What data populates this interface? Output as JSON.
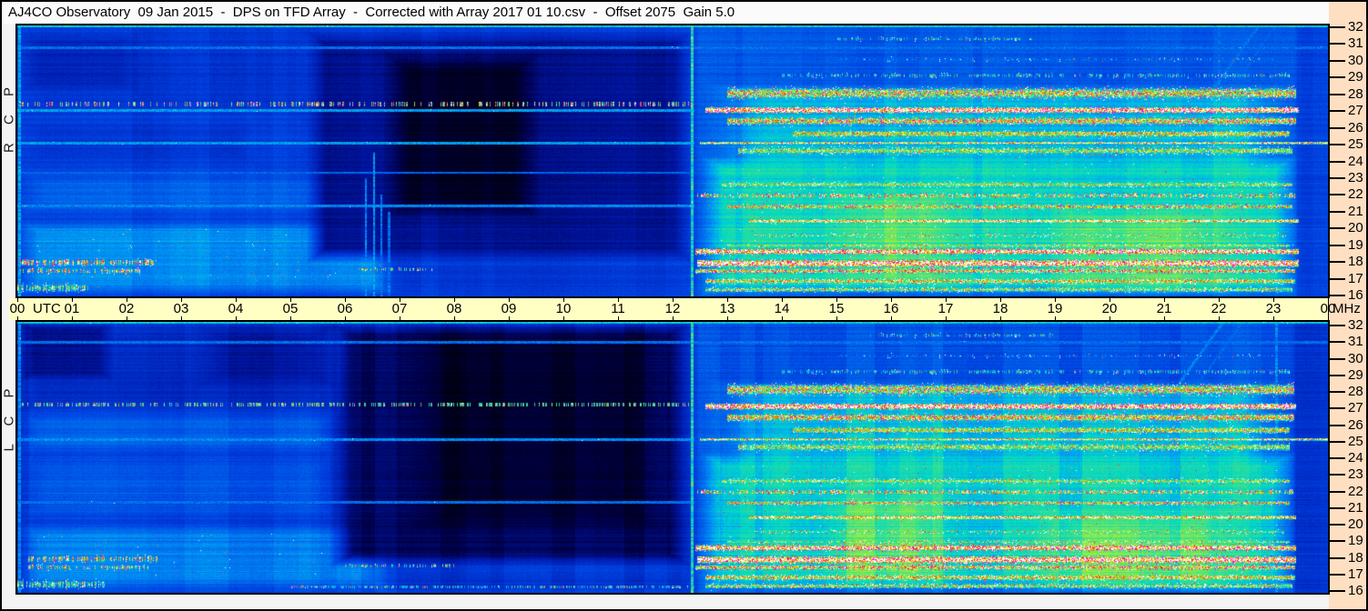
{
  "window": {
    "title": "AJ4CO Observatory  09 Jan 2015  -  DPS on TFD Array  -  Corrected with Array 2017 01 10.csv  -  Offset 2075  Gain 5.0"
  },
  "colors": {
    "outer_border": "#000000",
    "title_bg": "#fbfbfb",
    "margin_bg": "#f4f4f4",
    "time_strip_bg": "#ffffc4",
    "freq_col_bg": "#ffdfc2",
    "label_text": "#000000"
  },
  "time_axis": {
    "left_label": "00",
    "utc": "UTC",
    "hours": [
      "01",
      "02",
      "03",
      "04",
      "05",
      "06",
      "07",
      "08",
      "09",
      "10",
      "11",
      "12",
      "13",
      "14",
      "15",
      "16",
      "17",
      "18",
      "19",
      "20",
      "21",
      "22",
      "23"
    ],
    "right_label": "00",
    "unit": "MHz"
  },
  "freq_axis": {
    "ticks": [
      32,
      31,
      30,
      29,
      28,
      27,
      26,
      25,
      24,
      23,
      22,
      21,
      20,
      19,
      18,
      17,
      16
    ]
  },
  "chart_data": {
    "type": "heatmap",
    "title": "AJ4CO Observatory  09 Jan 2015  -  DPS on TFD Array  -  Corrected with Array 2017 01 10.csv  -  Offset 2075  Gain 5.0",
    "x_axis": {
      "label": "UTC",
      "unit": "hours",
      "min": 0,
      "max": 24
    },
    "y_axis": {
      "label": "MHz",
      "min": 16,
      "max": 32,
      "ticks": [
        32,
        31,
        30,
        29,
        28,
        27,
        26,
        25,
        24,
        23,
        22,
        21,
        20,
        19,
        18,
        17,
        16
      ]
    },
    "legend": "none",
    "notable_features": [
      "quiet blue background 00:00-12:20 UTC with black receiver-dropout region near 05:30-12:20",
      "broadband daytime emission 12:25-23:30 UTC with saturated white band at 27.0 MHz",
      "continuous carrier lines at 25.05 and 27 MHz; strong low-band lines at 16.4-22.6 MHz",
      "vertical calibration line at 12:21 UTC in both polarizations; early-morning bursts 17.5-18 MHz 00:00-02:30"
    ],
    "colormap": [
      [
        0.0,
        "#000000"
      ],
      [
        0.08,
        "#000048"
      ],
      [
        0.18,
        "#0018a8"
      ],
      [
        0.3,
        "#0040e0"
      ],
      [
        0.42,
        "#0078f0"
      ],
      [
        0.5,
        "#00a8f0"
      ],
      [
        0.57,
        "#00d8c8"
      ],
      [
        0.64,
        "#3ce08c"
      ],
      [
        0.72,
        "#90ec48"
      ],
      [
        0.8,
        "#e8f400"
      ],
      [
        0.86,
        "#ffb400"
      ],
      [
        0.92,
        "#ff5800"
      ],
      [
        0.96,
        "#ff1400"
      ],
      [
        1.0,
        "#ffffff"
      ]
    ],
    "overflow_colors": [
      "#ff00ff",
      "#ff0090",
      "#ee30ee"
    ],
    "panels": [
      {
        "id": "RCP",
        "polarization": "Right Circular Polarization",
        "side_label": "R C P",
        "seed": 11,
        "noise": {
          "row": 0.035,
          "col": 0.028,
          "grain": 0.06,
          "strong_row_p": 0.12,
          "strong_row_amp": 0.05
        },
        "regions": [
          [
            0,
            24,
            16,
            32,
            0.3,
            0,
            0
          ],
          [
            0,
            6.9,
            16,
            20.6,
            0.46,
            0.4,
            0.8
          ],
          [
            0,
            6.5,
            20.6,
            23.6,
            0.38,
            0.5,
            1.0
          ],
          [
            0,
            5.5,
            26.5,
            32,
            0.27,
            0.5,
            1.0
          ],
          [
            0,
            2.3,
            28.0,
            31.6,
            0.22,
            0.4,
            0.6
          ],
          [
            0,
            4.5,
            23.6,
            26.5,
            0.27,
            0.5,
            0.8
          ],
          [
            5.3,
            12.38,
            18.0,
            31.7,
            0.16,
            0.35,
            0.8
          ],
          [
            6.7,
            9.6,
            20.5,
            30.5,
            0.05,
            0.5,
            1.2
          ],
          [
            6.9,
            12.38,
            16,
            18.0,
            0.28,
            0.3,
            0.5
          ],
          [
            12.42,
            23.46,
            16,
            32,
            0.35,
            0.07,
            0
          ],
          [
            12.6,
            23.42,
            22.0,
            28.6,
            0.52,
            1.1,
            0.8
          ],
          [
            12.5,
            23.46,
            16,
            24.3,
            0.58,
            0.45,
            0.8
          ],
          [
            14.8,
            17.3,
            16.3,
            22.5,
            0.66,
            0.8,
            1.0
          ],
          [
            18.8,
            22.3,
            16,
            21.5,
            0.66,
            0.8,
            1.0
          ]
        ],
        "hlines": [
          [
            32.0,
            0.13,
            0,
            24,
            0.55,
            1,
            0
          ],
          [
            30.7,
            0.09,
            0,
            24,
            0.4,
            1,
            0
          ],
          [
            27.35,
            0.12,
            0,
            12.4,
            0.62,
            0.32,
            0.5
          ],
          [
            27.0,
            0.08,
            0,
            12.4,
            0.48,
            1,
            0
          ],
          [
            25.05,
            0.08,
            0,
            12.4,
            0.48,
            1,
            0
          ],
          [
            23.3,
            0.07,
            0,
            12.4,
            0.38,
            1,
            0
          ],
          [
            21.35,
            0.08,
            0,
            12.4,
            0.44,
            1,
            0
          ]
        ],
        "bands": [
          [
            28.0,
            0.45,
            13.0,
            23.42,
            0.74,
            0.28,
            1,
            1
          ],
          [
            27.0,
            0.22,
            12.6,
            23.46,
            1.02,
            0.5,
            1,
            1
          ],
          [
            26.35,
            0.3,
            13.0,
            23.42,
            0.8,
            0.3,
            1,
            1
          ],
          [
            25.6,
            0.25,
            14.2,
            23.3,
            0.78,
            0.22,
            0,
            1
          ],
          [
            25.05,
            0.09,
            12.5,
            24,
            0.97,
            0.15,
            1,
            1
          ],
          [
            24.6,
            0.3,
            13.2,
            23.35,
            0.7,
            0.15,
            0,
            1
          ],
          [
            29.05,
            0.18,
            14.0,
            23.3,
            0.55,
            0.12,
            1,
            0.5
          ],
          [
            30.0,
            0.15,
            15.0,
            23.0,
            0.42,
            0.08,
            0,
            0.4
          ],
          [
            31.2,
            0.15,
            15.0,
            18.6,
            0.55,
            0.15,
            0,
            0.4
          ],
          [
            22.6,
            0.2,
            12.9,
            23.35,
            0.68,
            0.18,
            0,
            1
          ],
          [
            21.95,
            0.18,
            12.45,
            23.4,
            0.85,
            0.3,
            1,
            0.65
          ],
          [
            21.3,
            0.18,
            13.0,
            23.35,
            0.75,
            0.25,
            1,
            1
          ],
          [
            20.45,
            0.14,
            13.4,
            23.46,
            0.95,
            0.25,
            0,
            1
          ],
          [
            19.6,
            0.15,
            13.5,
            23.2,
            0.6,
            0.12,
            0,
            1
          ],
          [
            19.0,
            0.12,
            13.0,
            23.3,
            0.7,
            0.15,
            0,
            1
          ],
          [
            18.65,
            0.22,
            12.42,
            23.46,
            0.98,
            0.45,
            1,
            1
          ],
          [
            17.95,
            0.28,
            12.45,
            23.46,
            1.0,
            0.4,
            1,
            1
          ],
          [
            17.5,
            0.18,
            12.42,
            23.4,
            0.8,
            0.35,
            1,
            1
          ],
          [
            16.9,
            0.2,
            12.6,
            23.4,
            0.78,
            0.3,
            0,
            1
          ],
          [
            16.4,
            0.2,
            12.6,
            23.35,
            0.68,
            0.2,
            0,
            1
          ],
          [
            18.0,
            0.25,
            0.05,
            2.5,
            0.82,
            0.45,
            1,
            0.55
          ],
          [
            17.5,
            0.2,
            0.05,
            2.3,
            0.75,
            0.4,
            1,
            0.5
          ],
          [
            16.5,
            0.35,
            0,
            1.3,
            0.62,
            0.2,
            0,
            0.8
          ],
          [
            17.6,
            0.15,
            6.2,
            7.6,
            0.72,
            0.35,
            1,
            0.35
          ]
        ],
        "vlines": [
          [
            12.35,
            2,
            16,
            32,
            0.6
          ],
          [
            6.38,
            1,
            16,
            23,
            0.45
          ],
          [
            6.52,
            1,
            16,
            24.5,
            0.48
          ],
          [
            6.66,
            1,
            16,
            22,
            0.44
          ],
          [
            6.8,
            1,
            16,
            21,
            0.4
          ],
          [
            22.0,
            1,
            16,
            32,
            0.4
          ],
          [
            0.03,
            2,
            16,
            32,
            0.5
          ]
        ],
        "diags": [
          [
            21.9,
            28.3,
            22.7,
            31.9,
            0.42,
            1.6
          ],
          [
            22.25,
            28.3,
            23.0,
            31.9,
            0.38,
            1.2
          ]
        ]
      },
      {
        "id": "LCP",
        "polarization": "Left Circular Polarization",
        "side_label": "L C P",
        "seed": 29,
        "noise": {
          "row": 0.035,
          "col": 0.05,
          "grain": 0.06,
          "strong_row_p": 0.14,
          "strong_row_amp": 0.05
        },
        "regions": [
          [
            0,
            24,
            16,
            32,
            0.28,
            0,
            0
          ],
          [
            0,
            6.8,
            16,
            20.2,
            0.42,
            0.4,
            0.8
          ],
          [
            0,
            5.9,
            20.2,
            24.2,
            0.33,
            0.5,
            1.0
          ],
          [
            0,
            5.9,
            24.2,
            26.7,
            0.35,
            0.4,
            0.6
          ],
          [
            0,
            5.9,
            26.7,
            32,
            0.23,
            0.5,
            0.8
          ],
          [
            0,
            1.8,
            28.5,
            32,
            0.14,
            0.3,
            0.5
          ],
          [
            3.2,
            5.9,
            28,
            32,
            0.17,
            0.6,
            1.0
          ],
          [
            5.7,
            12.38,
            17.5,
            32,
            0.1,
            0.45,
            0.8
          ],
          [
            7.2,
            11.9,
            19.5,
            31.8,
            0.05,
            0.8,
            1.4
          ],
          [
            6.8,
            12.38,
            16,
            17.5,
            0.26,
            0.3,
            0.5
          ],
          [
            12.42,
            23.42,
            16,
            32,
            0.34,
            0.07,
            0
          ],
          [
            12.6,
            23.4,
            22.0,
            28.6,
            0.52,
            1.1,
            0.8
          ],
          [
            12.5,
            23.42,
            16,
            24.3,
            0.57,
            0.45,
            0.8
          ],
          [
            14.6,
            17.2,
            16.3,
            22.0,
            0.65,
            0.8,
            1.0
          ],
          [
            18.6,
            22.4,
            16,
            21.0,
            0.66,
            0.8,
            1.0
          ]
        ],
        "hlines": [
          [
            32.0,
            0.13,
            0,
            24,
            0.55,
            1,
            0
          ],
          [
            30.8,
            0.09,
            0,
            24,
            0.4,
            1,
            0
          ],
          [
            27.1,
            0.12,
            0,
            12.4,
            0.62,
            0.42,
            0.3
          ],
          [
            25.05,
            0.08,
            0,
            12.4,
            0.45,
            1,
            0
          ],
          [
            21.35,
            0.07,
            0,
            12.4,
            0.4,
            1,
            0
          ],
          [
            16.35,
            0.1,
            5,
            12.4,
            0.5,
            0.5,
            0.2
          ]
        ],
        "bands": [
          [
            28.0,
            0.45,
            13.0,
            23.38,
            0.74,
            0.28,
            1,
            1
          ],
          [
            27.0,
            0.22,
            12.6,
            23.42,
            1.02,
            0.5,
            1,
            1
          ],
          [
            26.35,
            0.3,
            13.0,
            23.38,
            0.8,
            0.3,
            1,
            1
          ],
          [
            25.6,
            0.25,
            14.2,
            23.3,
            0.76,
            0.2,
            0,
            1
          ],
          [
            25.05,
            0.09,
            12.5,
            24,
            0.95,
            0.15,
            1,
            1
          ],
          [
            24.6,
            0.3,
            13.2,
            23.3,
            0.7,
            0.15,
            0,
            1
          ],
          [
            29.05,
            0.18,
            14.0,
            23.3,
            0.55,
            0.12,
            1,
            0.5
          ],
          [
            30.0,
            0.15,
            15.0,
            23.0,
            0.42,
            0.08,
            0,
            0.4
          ],
          [
            31.2,
            0.15,
            15.5,
            19.0,
            0.52,
            0.15,
            0,
            0.4
          ],
          [
            22.6,
            0.2,
            12.9,
            23.3,
            0.68,
            0.18,
            0,
            1
          ],
          [
            21.95,
            0.18,
            12.45,
            23.38,
            0.85,
            0.3,
            1,
            0.65
          ],
          [
            21.3,
            0.18,
            13.0,
            23.3,
            0.75,
            0.25,
            1,
            1
          ],
          [
            20.45,
            0.14,
            13.4,
            23.42,
            0.92,
            0.25,
            0,
            1
          ],
          [
            19.6,
            0.15,
            13.5,
            23.2,
            0.6,
            0.12,
            0,
            1
          ],
          [
            19.0,
            0.12,
            13.0,
            23.3,
            0.68,
            0.15,
            0,
            1
          ],
          [
            18.65,
            0.22,
            12.42,
            23.42,
            0.96,
            0.45,
            1,
            1
          ],
          [
            17.95,
            0.28,
            12.45,
            23.42,
            1.0,
            0.4,
            1,
            1
          ],
          [
            17.5,
            0.18,
            12.42,
            23.4,
            0.8,
            0.35,
            1,
            1
          ],
          [
            16.9,
            0.2,
            12.6,
            23.4,
            0.8,
            0.3,
            0,
            1
          ],
          [
            16.4,
            0.2,
            12.6,
            23.35,
            0.7,
            0.2,
            0,
            1
          ],
          [
            18.0,
            0.25,
            0.2,
            2.6,
            0.78,
            0.4,
            1,
            0.5
          ],
          [
            17.5,
            0.2,
            0.2,
            2.4,
            0.7,
            0.35,
            1,
            0.45
          ],
          [
            16.5,
            0.35,
            0,
            1.6,
            0.6,
            0.2,
            0,
            0.8
          ],
          [
            17.6,
            0.15,
            6.0,
            8.0,
            0.65,
            0.35,
            1,
            0.3
          ]
        ],
        "vlines": [
          [
            12.35,
            2,
            16,
            32,
            0.6
          ],
          [
            23.05,
            1,
            16,
            32,
            0.45
          ],
          [
            0.03,
            2,
            16,
            32,
            0.45
          ]
        ],
        "diags": [
          [
            21.25,
            28.3,
            22.05,
            31.9,
            0.45,
            1.6
          ],
          [
            21.6,
            28.3,
            22.4,
            31.9,
            0.4,
            1.2
          ]
        ]
      }
    ]
  }
}
